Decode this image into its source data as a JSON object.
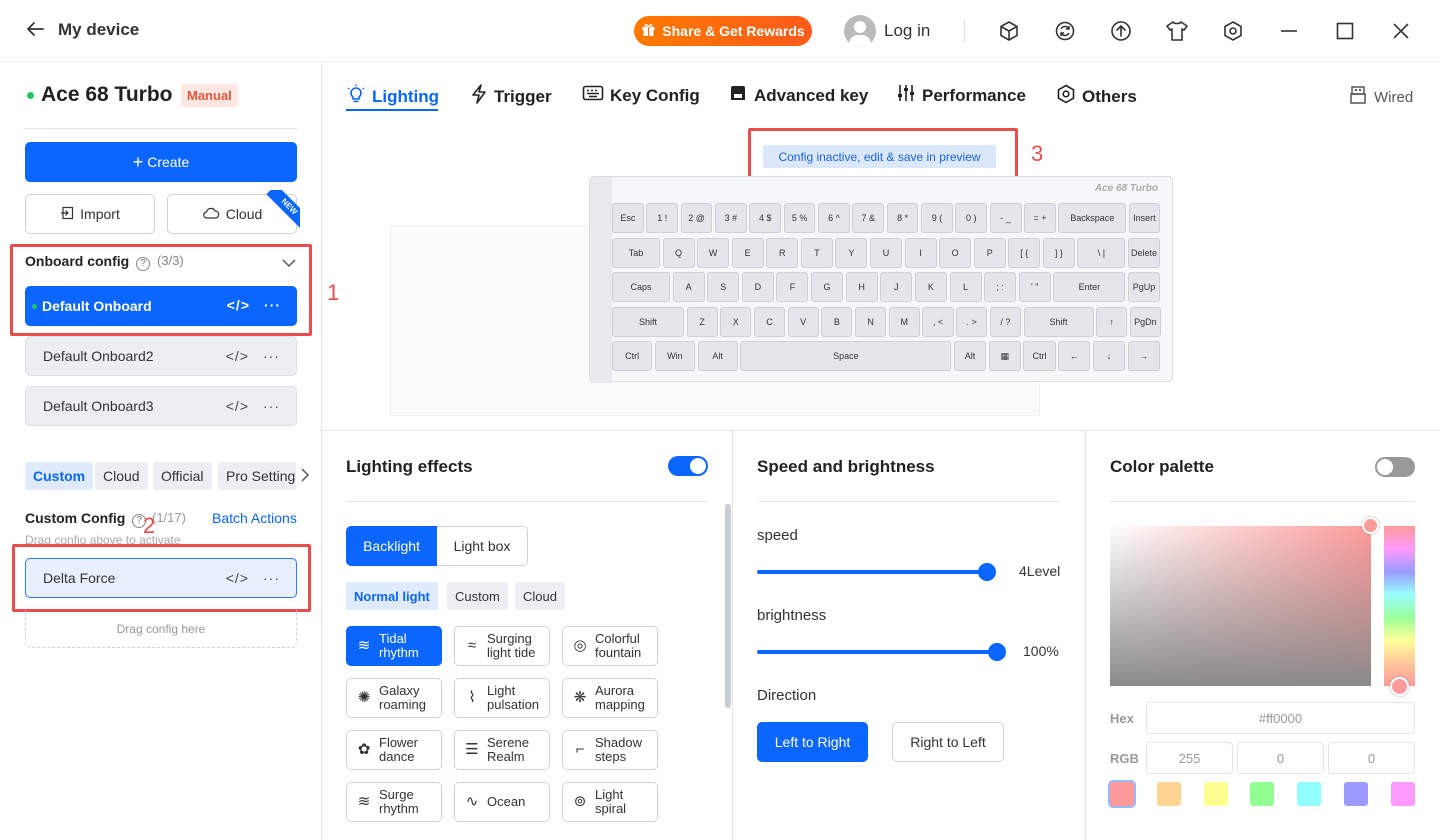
{
  "titlebar": {
    "title": "My device",
    "share_label": "Share & Get Rewards",
    "login_label": "Log in"
  },
  "device": {
    "name": "Ace 68 Turbo",
    "mode_badge": "Manual"
  },
  "sidebar": {
    "create_label": "Create",
    "import_label": "Import",
    "cloud_label": "Cloud",
    "new_badge": "NEW",
    "onboard_title": "Onboard config",
    "onboard_count": "(3/3)",
    "onboard_items": [
      "Default Onboard",
      "Default Onboard2",
      "Default Onboard3"
    ],
    "source_tabs": [
      "Custom",
      "Cloud",
      "Official",
      "Pro Settings"
    ],
    "custom_title": "Custom Config",
    "custom_count": "(1/17)",
    "batch_label": "Batch Actions",
    "drag_hint": "Drag config above to activate",
    "custom_items": [
      "Delta Force"
    ],
    "drop_label": "Drag config here"
  },
  "annotations": [
    "1",
    "2",
    "3"
  ],
  "nav": {
    "tabs": [
      "Lighting",
      "Trigger",
      "Key Config",
      "Advanced key",
      "Performance",
      "Others"
    ],
    "selected": "Lighting",
    "connection": "Wired"
  },
  "preview": {
    "inactive_notice": "Config inactive, edit & save in preview",
    "keyboard_brand": "Ace 68 Turbo",
    "rows": [
      [
        "Esc",
        "1 !",
        "2 @",
        "3 #",
        "4 $",
        "5 %",
        "6 ^",
        "7 &",
        "8 *",
        "9 (",
        "0 )",
        "- _",
        "= +",
        "Backspace",
        "Insert"
      ],
      [
        "Tab",
        "Q",
        "W",
        "E",
        "R",
        "T",
        "Y",
        "U",
        "I",
        "O",
        "P",
        "[ {",
        "] }",
        "\\ |",
        "Delete"
      ],
      [
        "Caps",
        "A",
        "S",
        "D",
        "F",
        "G",
        "H",
        "J",
        "K",
        "L",
        "; :",
        "' \"",
        "Enter",
        "PgUp"
      ],
      [
        "Shift",
        "Z",
        "X",
        "C",
        "V",
        "B",
        "N",
        "M",
        ", <",
        ". >",
        "/ ?",
        "Shift",
        "↑",
        "PgDn"
      ],
      [
        "Ctrl",
        "Win",
        "Alt",
        "Space",
        "Alt",
        "▦",
        "Ctrl",
        "←",
        "↓",
        "→"
      ]
    ]
  },
  "lighting_effects": {
    "title": "Lighting effects",
    "enabled": true,
    "modes": [
      "Backlight",
      "Light box"
    ],
    "selected_mode": "Backlight",
    "sources": [
      "Normal light",
      "Custom",
      "Cloud"
    ],
    "selected_source": "Normal light",
    "effects": [
      {
        "label": "Tidal rhythm",
        "icon": "waves-icon"
      },
      {
        "label": "Surging light tide",
        "icon": "tide-icon"
      },
      {
        "label": "Colorful fountain",
        "icon": "fountain-icon"
      },
      {
        "label": "Galaxy roaming",
        "icon": "galaxy-icon"
      },
      {
        "label": "Light pulsation",
        "icon": "pulse-icon"
      },
      {
        "label": "Aurora mapping",
        "icon": "aurora-icon"
      },
      {
        "label": "Flower dance",
        "icon": "flower-icon"
      },
      {
        "label": "Serene Realm",
        "icon": "lines-icon"
      },
      {
        "label": "Shadow steps",
        "icon": "steps-icon"
      },
      {
        "label": "Surge rhythm",
        "icon": "surge-icon"
      },
      {
        "label": "Ocean",
        "icon": "ocean-icon"
      },
      {
        "label": "Light spiral",
        "icon": "spiral-icon"
      }
    ],
    "selected_effect": "Tidal rhythm"
  },
  "speed_brightness": {
    "title": "Speed and brightness",
    "speed_label": "speed",
    "speed_value": "4Level",
    "speed_fraction": 0.96,
    "brightness_label": "brightness",
    "brightness_value": "100%",
    "brightness_fraction": 1.0,
    "direction_label": "Direction",
    "directions": [
      "Left to Right",
      "Right to Left"
    ],
    "selected_direction": "Left to Right"
  },
  "color_palette": {
    "title": "Color palette",
    "enabled": false,
    "hex_label": "Hex",
    "hex_value": "#ff0000",
    "rgb_label": "RGB",
    "rgb": [
      "255",
      "0",
      "0"
    ],
    "swatches": [
      "#ff9a9a",
      "#ffd591",
      "#ffff91",
      "#91ff91",
      "#91ffff",
      "#9a9aff",
      "#ff9aff"
    ]
  },
  "colors": {
    "accent": "#0a66ff",
    "share_gradient": "#ff7a00",
    "online_dot": "#27c46b",
    "annotation_red": "#e84d4d"
  }
}
